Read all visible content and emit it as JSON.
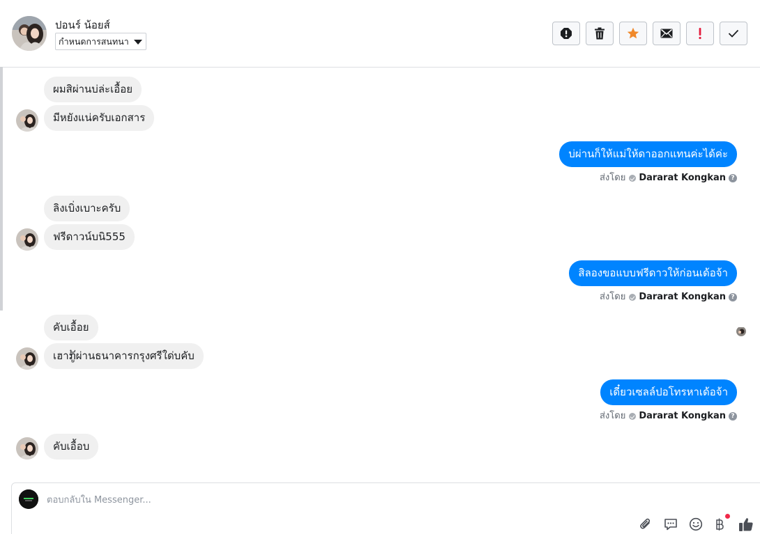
{
  "header": {
    "contact_name": "ปอนร์ น้อยส์",
    "label_select": "กำหนดการสนทนา",
    "toolbar_icons": [
      "report-icon",
      "trash-icon",
      "star-icon",
      "envelope-icon",
      "exclamation-icon",
      "check-icon"
    ]
  },
  "messages": [
    {
      "direction": "in",
      "text": "ผมสิผ่านบ่ล่ะเอื้อย"
    },
    {
      "direction": "in",
      "text": "มีหยังแน่ครับเอกสาร"
    },
    {
      "direction": "out",
      "text": "บ่ผ่านก็ให้แม่ให้ดาออกแทนค่ะได้ค่ะ",
      "sent_by_label": "ส่งโดย",
      "agent": "Dararat Kongkan"
    },
    {
      "direction": "in",
      "text": "ลิงเบิ่งเบาะครับ"
    },
    {
      "direction": "in",
      "text": "ฟรีดาวน์บนิ555"
    },
    {
      "direction": "out",
      "text": "สิลองขอแบบฟรีดาวให้ก่อนเด้อจ้า",
      "sent_by_label": "ส่งโดย",
      "agent": "Dararat Kongkan"
    },
    {
      "direction": "in",
      "text": "คับเอื้อย"
    },
    {
      "direction": "in",
      "text": "เฮาກູ້ผ่านธนาคารกรุงศรีใด่บคับ"
    },
    {
      "direction": "out",
      "text": "เดี๋ยวเซลล์ปอโทรหาเด้อจ้า",
      "sent_by_label": "ส่งโดย",
      "agent": "Dararat Kongkan"
    },
    {
      "direction": "in",
      "text": "คับเอื้อบ"
    }
  ],
  "composer": {
    "placeholder": "ตอบกลับใน Messenger...",
    "icons": [
      "paperclip-icon",
      "saved-reply-icon",
      "emoji-icon",
      "baht-icon",
      "thumbs-up-icon"
    ]
  },
  "colors": {
    "outgoing_bubble": "#0084ff",
    "incoming_bubble": "#f0f0f0",
    "star": "#f0892b",
    "exclamation": "#e41e3f"
  }
}
